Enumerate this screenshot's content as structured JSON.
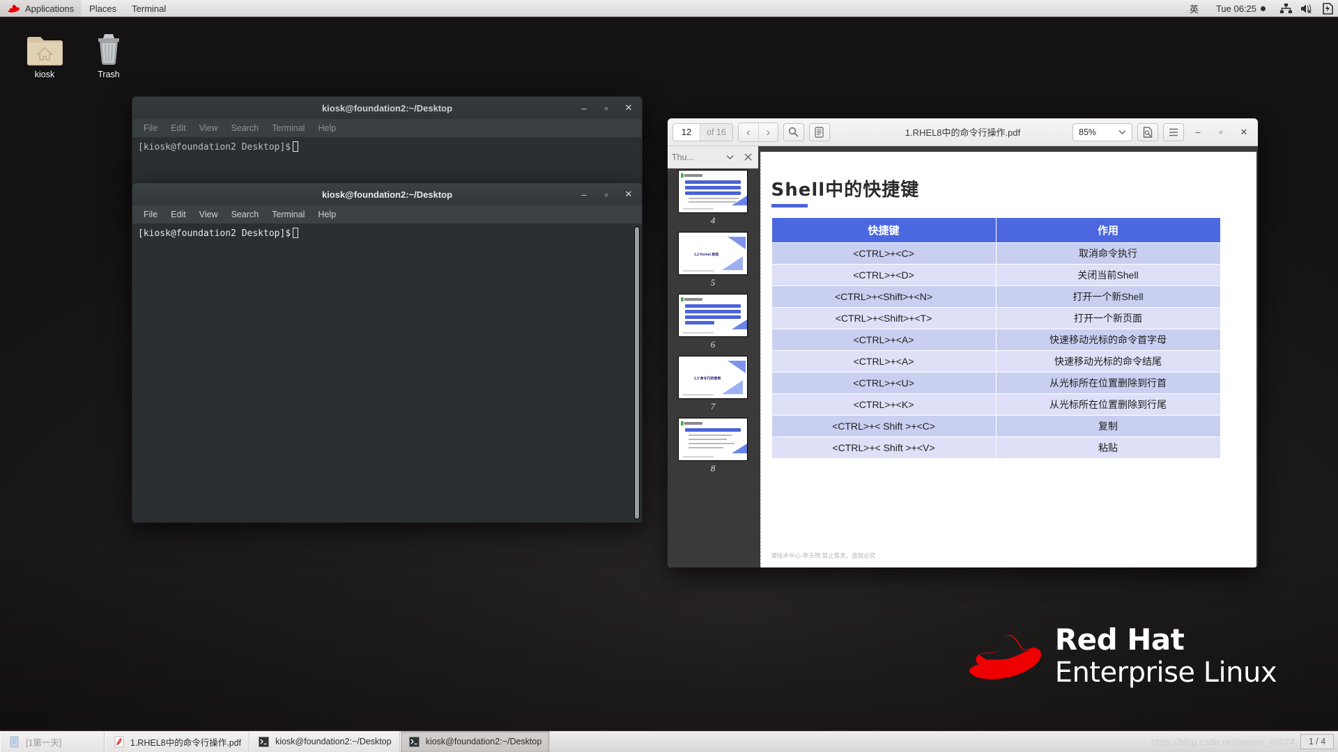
{
  "top_panel": {
    "logo_icon": "red-hat-logo-icon",
    "menus": [
      "Applications",
      "Places",
      "Terminal"
    ],
    "input_method": "英",
    "clock": "Tue 06:25",
    "tray": [
      {
        "icon": "network-icon",
        "name": "network-tray-icon"
      },
      {
        "icon": "volume-muted-icon",
        "name": "volume-tray-icon"
      },
      {
        "icon": "battery-charging-icon",
        "name": "battery-tray-icon"
      }
    ]
  },
  "desktop_icons": [
    {
      "label": "kiosk",
      "icon": "home-folder-icon"
    },
    {
      "label": "Trash",
      "icon": "trash-icon"
    }
  ],
  "terminals": [
    {
      "title": "kiosk@foundation2:~/Desktop",
      "menus": [
        "File",
        "Edit",
        "View",
        "Search",
        "Terminal",
        "Help"
      ],
      "prompt": "[kiosk@foundation2 Desktop]$",
      "minimize_label": "–",
      "maximize_label": "▫",
      "close_label": "✕"
    },
    {
      "title": "kiosk@foundation2:~/Desktop",
      "menus": [
        "File",
        "Edit",
        "View",
        "Search",
        "Terminal",
        "Help"
      ],
      "prompt": "[kiosk@foundation2 Desktop]$",
      "minimize_label": "–",
      "maximize_label": "▫",
      "close_label": "✕"
    }
  ],
  "pdf_viewer": {
    "document_title": "1.RHEL8中的命令行操作.pdf",
    "current_page": "12",
    "page_total_label": "of 16",
    "zoom_level": "85%",
    "prev_label": "‹",
    "next_label": "›",
    "search_icon": "search-icon",
    "sidebar_toggle_icon": "sidebar-toggle-icon",
    "print_icon": "print-preview-icon",
    "menu_icon": "hamburger-menu-icon",
    "minimize_label": "–",
    "maximize_label": "▫",
    "close_label": "✕",
    "sidebar": {
      "label": "Thu...",
      "dropdown_icon": "chevron-down-icon",
      "close_icon": "close-icon",
      "thumbnails": [
        "4",
        "5",
        "6",
        "7",
        "8"
      ]
    },
    "slide": {
      "title": "Shell中的快捷键",
      "footer": "源技术中心-李天明  禁止售卖，盗版必究",
      "table": {
        "headers": [
          "快捷键",
          "作用"
        ],
        "rows": [
          [
            "<CTRL>+<C>",
            "取消命令执行"
          ],
          [
            "<CTRL>+<D>",
            "关闭当前Shell"
          ],
          [
            "<CTRL>+<Shift>+<N>",
            "打开一个新Shell"
          ],
          [
            "<CTRL>+<Shift>+<T>",
            "打开一个新页面"
          ],
          [
            "<CTRL>+<A>",
            "快速移动光标的命令首字母"
          ],
          [
            "<CTRL>+<A>",
            "快速移动光标的命令结尾"
          ],
          [
            "<CTRL>+<U>",
            "从光标所在位置删除到行首"
          ],
          [
            "<CTRL>+<K>",
            "从光标所在位置删除到行尾"
          ],
          [
            "<CTRL>+< Shift >+<C>",
            "复制"
          ],
          [
            "<CTRL>+< Shift >+<V>",
            "粘贴"
          ]
        ]
      }
    }
  },
  "branding": {
    "line1": "Red Hat",
    "line2": "Enterprise Linux",
    "hat_icon": "red-hat-fedora-icon"
  },
  "taskbar": {
    "items": [
      {
        "label": "[1第一天]",
        "icon": "document-icon",
        "active": false,
        "dim": true
      },
      {
        "label": "1.RHEL8中的命令行操作.pdf",
        "icon": "pdf-icon",
        "active": false,
        "dim": false
      },
      {
        "label": "kiosk@foundation2:~/Desktop",
        "icon": "terminal-icon",
        "active": false,
        "dim": false
      },
      {
        "label": "kiosk@foundation2:~/Desktop",
        "icon": "terminal-icon",
        "active": true,
        "dim": false
      }
    ],
    "watermark": "https://blog.csdn.net/weixin_46074",
    "workspace": "1 / 4"
  },
  "colors": {
    "table_header": "#4c68e0",
    "table_row_odd": "#c9cff0",
    "table_row_even": "#dde0f7",
    "redhat_red": "#ee0000",
    "desktop_bg": "#1f1c1c"
  }
}
